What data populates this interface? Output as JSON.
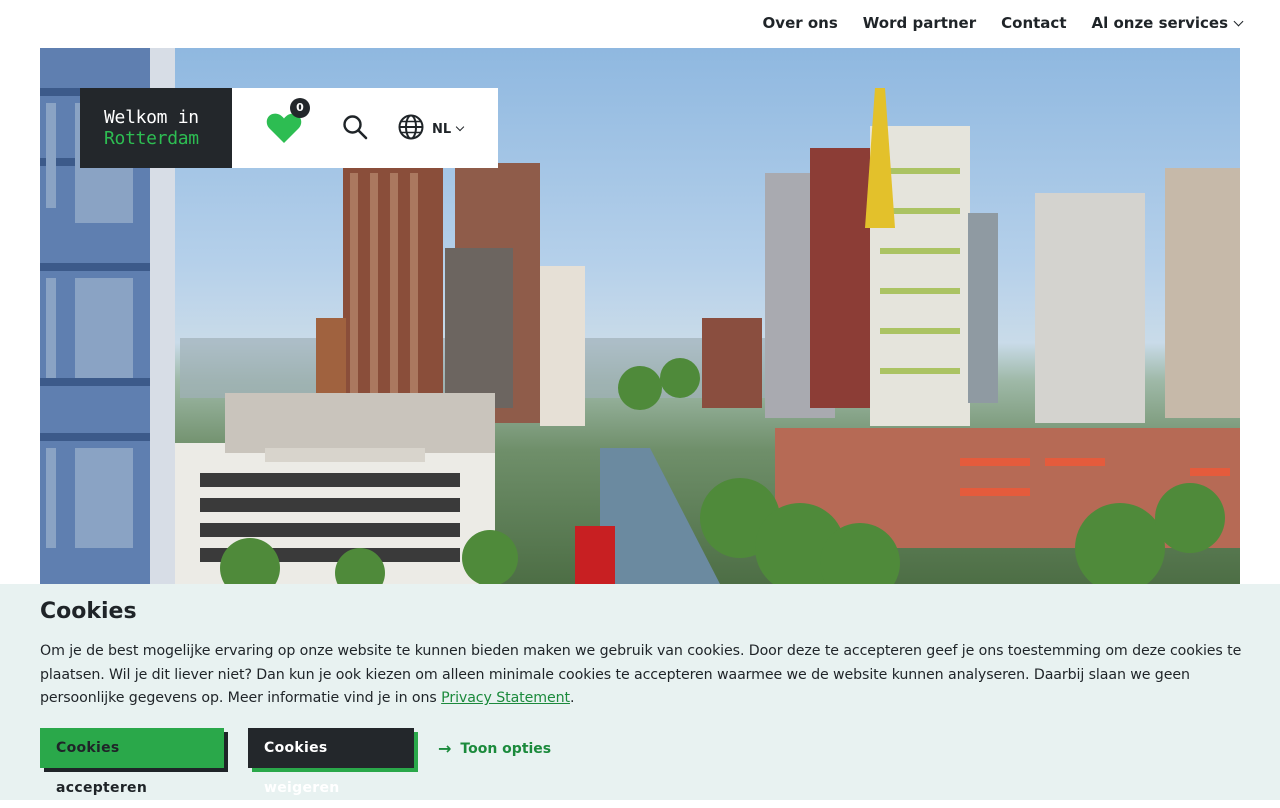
{
  "nav": {
    "items": [
      "Over ons",
      "Word partner",
      "Contact"
    ],
    "services_label": "Al onze services"
  },
  "header": {
    "logo_line1": "Welkom in",
    "logo_line2": "Rotterdam",
    "favorites_count": "0",
    "language": "NL"
  },
  "hero": {
    "image_alt": "Rotterdam skyline"
  },
  "cookie": {
    "title": "Cookies",
    "text": "Om je de best mogelijke ervaring op onze website te kunnen bieden maken we gebruik van cookies. Door deze te accepteren geef je ons toestemming om deze cookies te plaatsen. Wil je dit liever niet? Dan kun je ook kiezen om alleen minimale cookies te accepteren waarmee we de website kunnen analyseren. Daarbij slaan we geen persoonlijke gegevens op. Meer informatie vind je in ons ",
    "privacy_link": "Privacy Statement",
    "period": ".",
    "accept_label": "Cookies accepteren",
    "reject_label": "Cookies weigeren",
    "options_label": "Toon opties"
  },
  "colors": {
    "brand_green": "#2aa84a",
    "dark": "#23272b",
    "banner_bg": "#e8f2f1"
  }
}
